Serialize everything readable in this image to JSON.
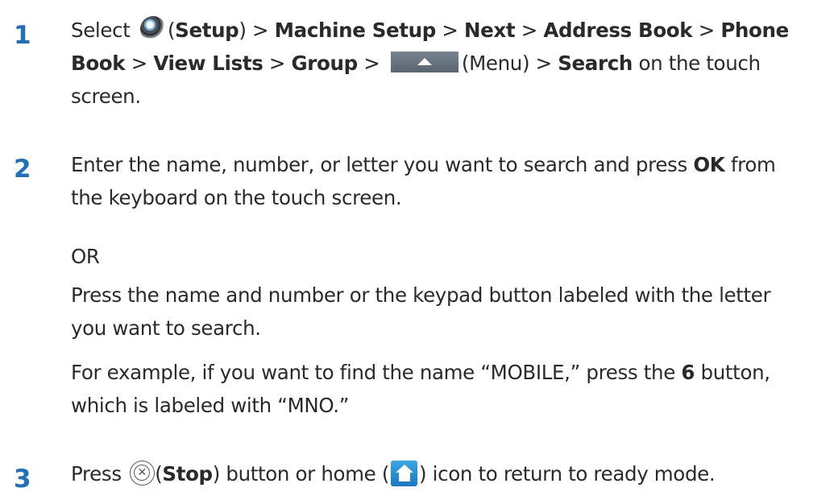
{
  "steps": [
    {
      "number": "1",
      "select": "Select",
      "setup_open": "(",
      "setup": "Setup",
      "setup_close": ") >",
      "machine_setup": "Machine Setup",
      "gt1": ">",
      "next": "Next",
      "gt2": ">",
      "address_book": "Address Book",
      "gt3": ">",
      "phone": "Phone",
      "book": "Book",
      "gt4": ">",
      "view_lists": "View Lists",
      "gt5": ">",
      "group": "Group",
      "gt6": ">",
      "menu_text": "(Menu) >",
      "search": "Search",
      "on_touch": "on the touch",
      "screen": "screen."
    },
    {
      "number": "2",
      "line1_pre": "Enter the name, number, or letter you want to search and press",
      "ok": "OK",
      "from": "from",
      "line2": "the keyboard on the touch screen.",
      "or": "OR",
      "press_line1": "Press the name and number or the keypad button labeled with the letter",
      "press_line2": "you want to search.",
      "example_pre": "For example, if you want to find the name “MOBILE,” press the",
      "six": "6",
      "button_comma": "button,",
      "example_line2": "which is labeled with “MNO.”"
    },
    {
      "number": "3",
      "press": "Press",
      "stop_open": "(",
      "stop": "Stop",
      "stop_after": ") button or home (",
      "icon_after": ") icon to return to ready mode.",
      "stop_glyph": "✕"
    }
  ],
  "icons": {
    "setup": "gear-icon",
    "menu": "menu-up-arrow-icon",
    "stop": "stop-circle-x-icon",
    "home": "home-icon"
  },
  "colors": {
    "step_number": "#1f6fba",
    "text": "#2a2a2a"
  }
}
